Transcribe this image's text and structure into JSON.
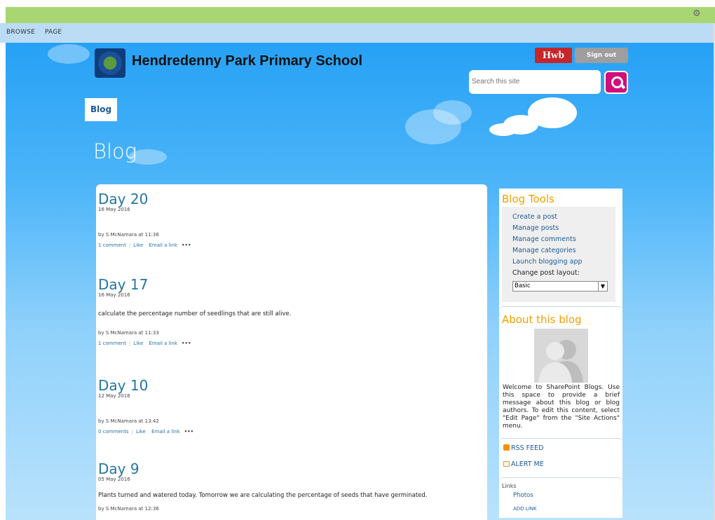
{
  "ribbon": {
    "browse": "BROWSE",
    "page": "PAGE"
  },
  "site": {
    "title": "Hendredenny Park Primary School"
  },
  "header": {
    "hwb": "Hwb",
    "sign_out": "Sign out",
    "search_placeholder": "Search this site"
  },
  "nav": {
    "blog": "Blog"
  },
  "page_title": "Blog",
  "posts": [
    {
      "title": "Day 20",
      "date": "16 May 2016",
      "body": "",
      "by": "by S McNamara at 11:36",
      "comments": "1 comment",
      "like": "Like",
      "email": "Email a link",
      "more": "•••"
    },
    {
      "title": "Day 17",
      "date": "16 May 2016",
      "body": "calculate the percentage number of seedlings that are still alive.",
      "by": "by S McNamara at 11:33",
      "comments": "1 comment",
      "like": "Like",
      "email": "Email a link",
      "more": "•••"
    },
    {
      "title": "Day 10",
      "date": "12 May 2016",
      "body": "",
      "by": "by S McNamara at 13:42",
      "comments": "0 comments",
      "like": "Like",
      "email": "Email a link",
      "more": "•••"
    },
    {
      "title": "Day 9",
      "date": "05 May 2016",
      "body": "Plants turned and watered today. Tomorrow we are calculating the percentage of seeds that have germinated.",
      "by": "by S McNamara at 12:36"
    }
  ],
  "sidebar": {
    "tools_title": "Blog Tools",
    "links": [
      "Create a post",
      "Manage posts",
      "Manage comments",
      "Manage categories",
      "Launch blogging app"
    ],
    "layout_label": "Change post layout:",
    "layout_value": "Basic",
    "about_title": "About this blog",
    "about_text": "Welcome to SharePoint Blogs. Use this space to provide a brief message about this blog or blog authors. To edit this content, select \"Edit Page\" from the \"Site Actions\" menu.",
    "rss": "RSS FEED",
    "alert": "ALERT ME",
    "links_label": "Links",
    "links_photos": "Photos",
    "links_add": "ADD LINK"
  },
  "colors": {
    "topbar": "#a8d672",
    "sky": "#26a1f5",
    "accent": "#f0a000",
    "search_button": "#d10e79",
    "hwb": "#c6262a"
  }
}
